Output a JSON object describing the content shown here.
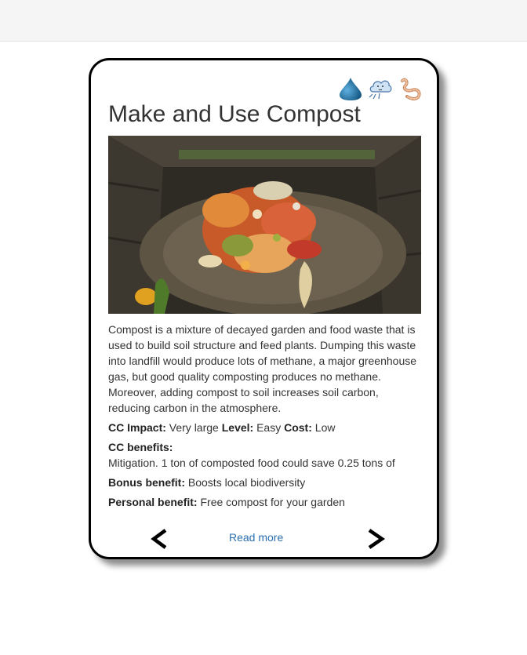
{
  "header": {},
  "card": {
    "icons": [
      "water-drop-icon",
      "cloud-wind-icon",
      "worm-icon"
    ],
    "title": "Make and Use Compost",
    "image": "compost-bin-photo",
    "description": "Compost is a mixture of decayed garden and food waste that is used to build soil structure and feed plants. Dumping this waste into landfill would produce lots of methane, a major greenhouse gas, but good quality composting produces no methane. Moreover, adding compost to soil increases soil carbon, reducing carbon in the atmosphere.",
    "impact_label": "CC Impact:",
    "impact_value": "Very large",
    "level_label": "Level:",
    "level_value": "Easy",
    "cost_label": "Cost:",
    "cost_value": "Low",
    "benefits_label": "CC benefits:",
    "benefits_text": "Mitigation. 1 ton of composted food could save 0.25 tons of",
    "bonus_label": "Bonus benefit:",
    "bonus_value": "Boosts local biodiversity",
    "personal_label": "Personal benefit:",
    "personal_value": "Free compost for your garden",
    "read_more": "Read more",
    "prev_glyph": "<",
    "next_glyph": ">"
  },
  "colors": {
    "accent_link": "#2a6fb0",
    "card_border": "#000000",
    "drop": "#1f6fa3"
  }
}
